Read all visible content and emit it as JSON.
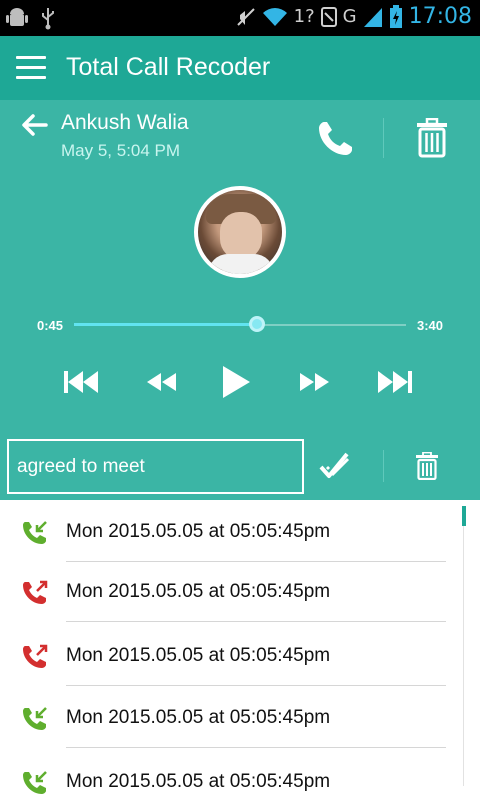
{
  "status_bar": {
    "time": "17:08",
    "network": "G",
    "colors": {
      "accent": "#33b5e5"
    }
  },
  "app_bar": {
    "title": "Total Call Recoder",
    "background": "#1ea896"
  },
  "player": {
    "contact_name": "Ankush Walia",
    "call_date": "May 5, 5:04 PM",
    "elapsed": "0:45",
    "duration": "3:40",
    "progress_fraction": 0.55,
    "controls": [
      "skip-previous-icon",
      "rewind-icon",
      "play-icon",
      "fast-forward-icon",
      "skip-next-icon"
    ],
    "background": "#3bb5a5"
  },
  "note": {
    "value": "agreed to meet"
  },
  "recordings": [
    {
      "label": "Mon 2015.05.05 at 05:05:45pm",
      "type": "incoming",
      "icon_color": "#5fae2e"
    },
    {
      "label": "Mon 2015.05.05 at 05:05:45pm",
      "type": "outgoing",
      "icon_color": "#d32f2f"
    },
    {
      "label": "Mon 2015.05.05 at 05:05:45pm",
      "type": "outgoing",
      "icon_color": "#d32f2f"
    },
    {
      "label": "Mon 2015.05.05 at 05:05:45pm",
      "type": "incoming",
      "icon_color": "#5fae2e"
    },
    {
      "label": "Mon 2015.05.05 at 05:05:45pm",
      "type": "incoming",
      "icon_color": "#5fae2e"
    }
  ]
}
